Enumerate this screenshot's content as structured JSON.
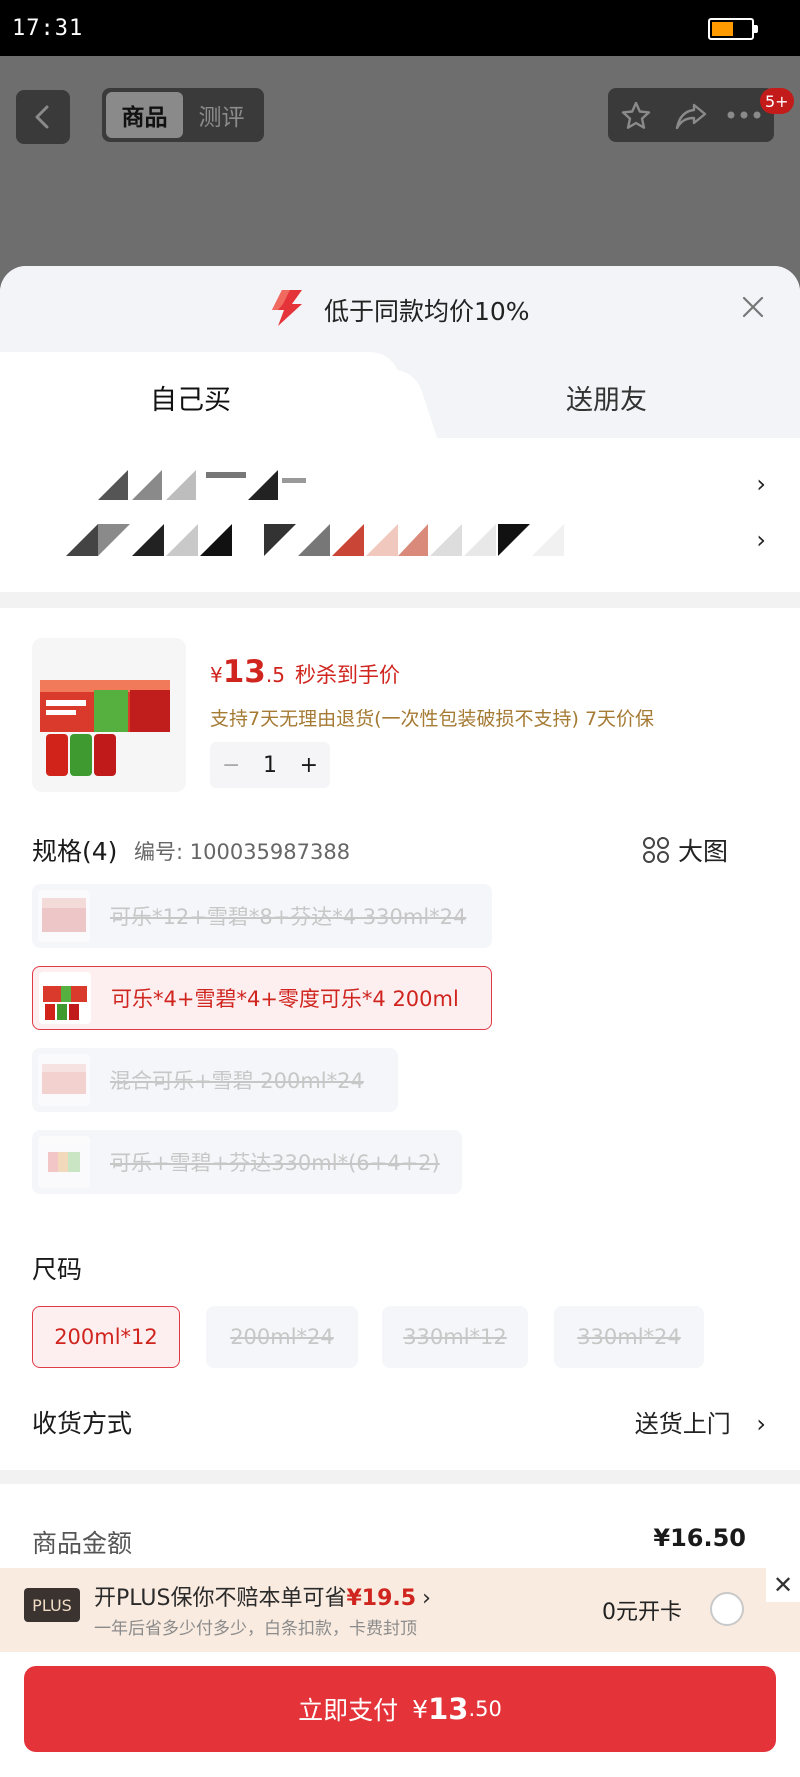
{
  "status_bar": {
    "time": "17:31",
    "battery_level": 0.55
  },
  "header": {
    "tabs": [
      {
        "label": "商品",
        "active": true
      },
      {
        "label": "测评",
        "active": false
      }
    ],
    "badge": "5+",
    "icons": [
      "back-arrow-icon",
      "star-icon",
      "share-icon",
      "more-icon"
    ]
  },
  "promo": {
    "text": "低于同款均价10%"
  },
  "buy_tabs": [
    {
      "label": "自己买",
      "active": true
    },
    {
      "label": "送朋友",
      "active": false
    }
  ],
  "product": {
    "price_currency": "¥",
    "price_int": "13",
    "price_dec": ".5",
    "price_note": "秒杀到手价",
    "service": "支持7天无理由退货(一次性包装破损不支持) 7天价保",
    "quantity": "1"
  },
  "spec": {
    "title": "规格(4)",
    "code": "编号: 100035987388",
    "big_image": "大图",
    "options": [
      {
        "label": "可乐*12+雪碧*8+芬达*4 330ml*24",
        "selected": false,
        "available": false
      },
      {
        "label": "可乐*4+雪碧*4+零度可乐*4 200ml",
        "selected": true,
        "available": true
      },
      {
        "label": "混合可乐+雪碧 200ml*24",
        "selected": false,
        "available": false
      },
      {
        "label": "可乐+雪碧+芬达330ml*(6+4+2)",
        "selected": false,
        "available": false
      }
    ]
  },
  "size": {
    "title": "尺码",
    "options": [
      {
        "label": "200ml*12",
        "selected": true
      },
      {
        "label": "200ml*24",
        "selected": false
      },
      {
        "label": "330ml*12",
        "selected": false
      },
      {
        "label": "330ml*24",
        "selected": false
      }
    ]
  },
  "delivery": {
    "label": "收货方式",
    "value": "送货上门"
  },
  "amount": {
    "label": "商品金额",
    "value": "¥16.50"
  },
  "plus": {
    "logo": "PLUS",
    "line1_prefix": "开PLUS保你不赔本单可省",
    "line1_amount": "¥19.5",
    "line2": "一年后省多少付多少，白条扣款，卡费封顶",
    "open_label": "0元开卡"
  },
  "pay": {
    "label": "立即支付",
    "currency": "¥",
    "amount_int": "13",
    "amount_dec": ".50"
  },
  "colors": {
    "accent": "#e4343a",
    "price": "#d0251f",
    "service": "#a57a33"
  }
}
